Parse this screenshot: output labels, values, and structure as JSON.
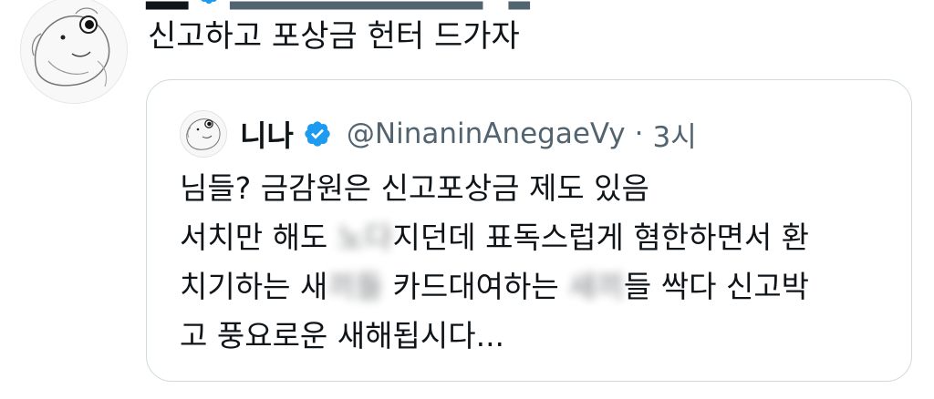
{
  "tweet": {
    "text": "신고하고 포상금 헌터 드가자",
    "avatar_icon": "avatar-sketch-icon"
  },
  "quote": {
    "author_name": "니나",
    "verified_icon": "verified-badge-icon",
    "verified_color": "#1d9bf0",
    "handle": "@NinaninAnegaeVy",
    "separator": "·",
    "time": "3시",
    "lines": [
      [
        "님들? 금감원은 신고포상금 제도 있음"
      ],
      [
        "서치만 해도 ",
        "노다",
        "지던데 표독스럽게 혐한하면서 환"
      ],
      [
        "치기하는 새",
        "끼들",
        " 카드대여하는 ",
        "새끼",
        "들 싹다 신고박"
      ],
      [
        "고 풍요로운 새해됩시다..."
      ]
    ]
  },
  "colors": {
    "text_primary": "#0f1419",
    "text_secondary": "#536471",
    "border": "#cfd9de",
    "background": "#ffffff"
  }
}
